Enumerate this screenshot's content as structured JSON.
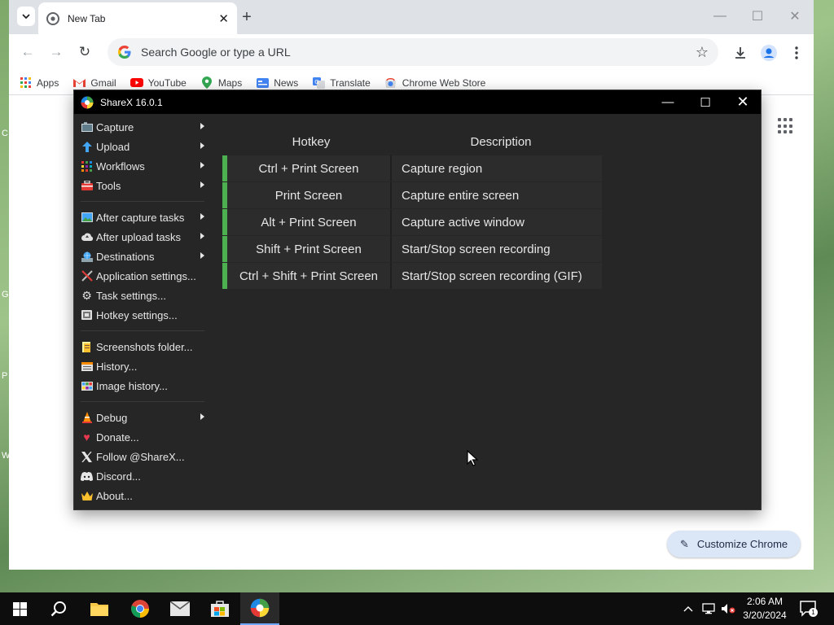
{
  "browser": {
    "tab": {
      "title": "New Tab"
    },
    "omnibox": {
      "placeholder": "Search Google or type a URL"
    },
    "bookmarks": [
      {
        "label": "Apps",
        "icon": "apps-grid-icon"
      },
      {
        "label": "Gmail",
        "icon": "gmail-icon"
      },
      {
        "label": "YouTube",
        "icon": "youtube-icon"
      },
      {
        "label": "Maps",
        "icon": "maps-icon"
      },
      {
        "label": "News",
        "icon": "news-icon"
      },
      {
        "label": "Translate",
        "icon": "translate-icon"
      },
      {
        "label": "Chrome Web Store",
        "icon": "web-store-icon"
      }
    ],
    "customize_label": "Customize Chrome"
  },
  "sharex": {
    "title": "ShareX 16.0.1",
    "menu": [
      {
        "label": "Capture",
        "icon": "capture-icon",
        "submenu": true
      },
      {
        "label": "Upload",
        "icon": "upload-icon",
        "submenu": true
      },
      {
        "label": "Workflows",
        "icon": "workflows-icon",
        "submenu": true
      },
      {
        "label": "Tools",
        "icon": "tools-icon",
        "submenu": true
      },
      {
        "separator": true
      },
      {
        "label": "After capture tasks",
        "icon": "after-capture-icon",
        "submenu": true
      },
      {
        "label": "After upload tasks",
        "icon": "after-upload-icon",
        "submenu": true
      },
      {
        "label": "Destinations",
        "icon": "destinations-icon",
        "submenu": true
      },
      {
        "label": "Application settings...",
        "icon": "app-settings-icon",
        "submenu": false
      },
      {
        "label": "Task settings...",
        "icon": "task-settings-icon",
        "submenu": false
      },
      {
        "label": "Hotkey settings...",
        "icon": "hotkey-settings-icon",
        "submenu": false
      },
      {
        "separator": true
      },
      {
        "label": "Screenshots folder...",
        "icon": "folder-icon",
        "submenu": false
      },
      {
        "label": "History...",
        "icon": "history-icon",
        "submenu": false
      },
      {
        "label": "Image history...",
        "icon": "image-history-icon",
        "submenu": false
      },
      {
        "separator": true
      },
      {
        "label": "Debug",
        "icon": "debug-icon",
        "submenu": true
      },
      {
        "label": "Donate...",
        "icon": "heart-icon",
        "submenu": false
      },
      {
        "label": "Follow @ShareX...",
        "icon": "x-logo-icon",
        "submenu": false
      },
      {
        "label": "Discord...",
        "icon": "discord-icon",
        "submenu": false
      },
      {
        "label": "About...",
        "icon": "crown-icon",
        "submenu": false
      }
    ],
    "hotkeys": {
      "headers": {
        "hotkey": "Hotkey",
        "description": "Description"
      },
      "rows": [
        {
          "hotkey": "Ctrl + Print Screen",
          "description": "Capture region"
        },
        {
          "hotkey": "Print Screen",
          "description": "Capture entire screen"
        },
        {
          "hotkey": "Alt + Print Screen",
          "description": "Capture active window"
        },
        {
          "hotkey": "Shift + Print Screen",
          "description": "Start/Stop screen recording"
        },
        {
          "hotkey": "Ctrl + Shift + Print Screen",
          "description": "Start/Stop screen recording (GIF)"
        }
      ],
      "status_color": "#4caf50"
    }
  },
  "taskbar": {
    "clock": {
      "time": "2:06 AM",
      "date": "3/20/2024"
    },
    "notification_count": "1"
  }
}
